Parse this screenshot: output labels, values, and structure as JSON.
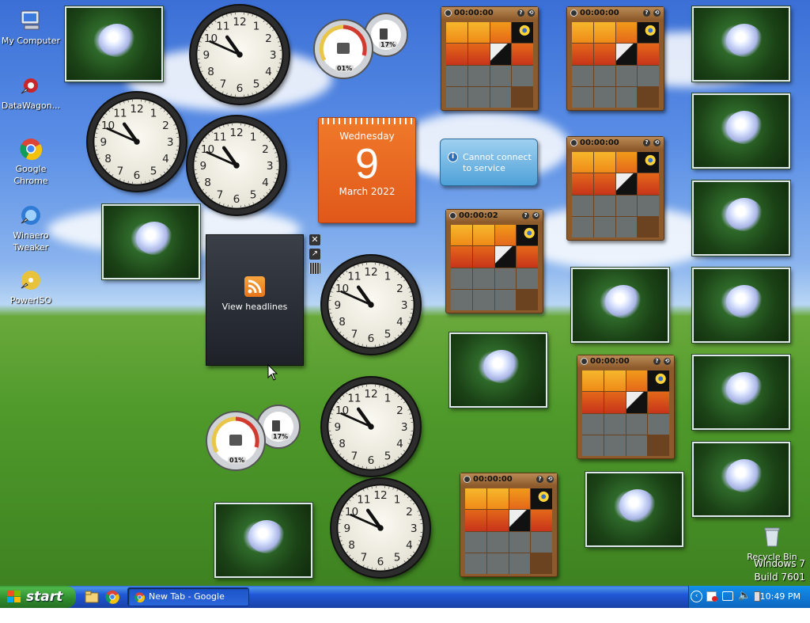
{
  "desktop": {
    "icons": [
      {
        "label": "My Computer",
        "icon": "my-computer-icon"
      },
      {
        "label": "DataWagon...",
        "icon": "datawagon-icon"
      },
      {
        "label": "Google Chrome",
        "icon": "chrome-icon"
      },
      {
        "label": "Winaero Tweaker",
        "icon": "winaero-icon"
      },
      {
        "label": "PowerISO",
        "icon": "poweriso-icon"
      }
    ],
    "recycle_bin": "Recycle Bin",
    "watermark_line1": "Windows 7",
    "watermark_line2": "Build 7601"
  },
  "gadgets": {
    "calendar": {
      "weekday": "Wednesday",
      "day": "9",
      "month_year": "March 2022",
      "color": "#e8651a"
    },
    "weather": {
      "message_line1": "Cannot connect",
      "message_line2": "to service"
    },
    "feed": {
      "label": "View headlines"
    },
    "cpu_meter": {
      "cpu": "01%",
      "ram": "17%"
    },
    "puzzle_timers": [
      "00:00:00",
      "00:00:00",
      "00:00:00",
      "00:00:02",
      "00:00:00",
      "00:00:00"
    ],
    "clock_time": "10:49"
  },
  "taskbar": {
    "start_label": "start",
    "task_label": "New Tab - Google Chr...",
    "clock": "10:49 PM"
  }
}
